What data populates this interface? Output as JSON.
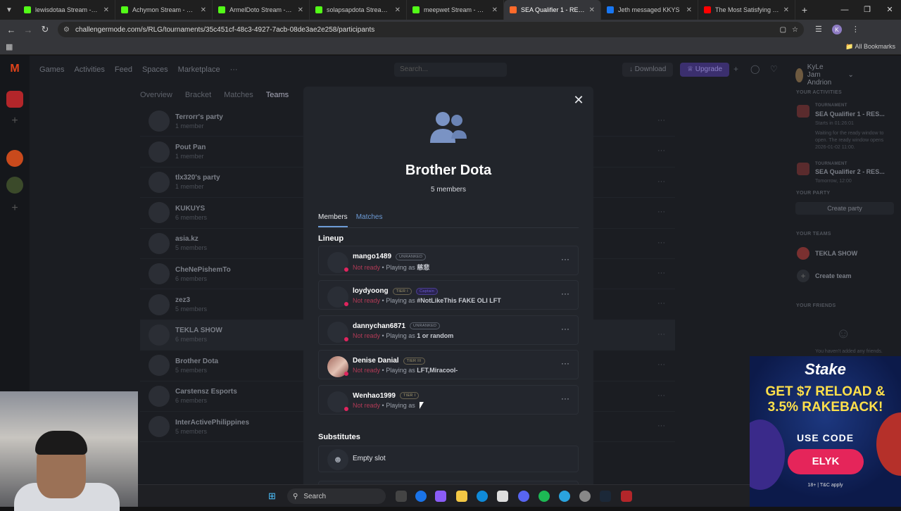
{
  "browser": {
    "tabs": [
      {
        "title": "lewisdotaa Stream - Watc",
        "fav": "#53fc18"
      },
      {
        "title": "Achymon Stream - Watch",
        "fav": "#53fc18"
      },
      {
        "title": "ArmelDoto Stream - Watc",
        "fav": "#53fc18"
      },
      {
        "title": "solapsapdota Stream - W",
        "fav": "#53fc18"
      },
      {
        "title": "meepwet Stream - Watch",
        "fav": "#53fc18"
      },
      {
        "title": "SEA Qualifier 1 - RES Unc",
        "fav": "#ff6a2b"
      },
      {
        "title": "Jeth messaged KKYS",
        "fav": "#1877f2"
      },
      {
        "title": "The Most Satisfying Beat",
        "fav": "#ff0000"
      }
    ],
    "url": "challengermode.com/s/RLG/tournaments/35c451cf-48c3-4927-7acb-08de3ae2e258/participants",
    "all_bookmarks": "All Bookmarks",
    "profile_initial": "K"
  },
  "topnav": {
    "items": [
      "Games",
      "Activities",
      "Feed",
      "Spaces",
      "Marketplace",
      "···"
    ],
    "search_placeholder": "Search...",
    "download": "Download",
    "upgrade": "Upgrade",
    "username": "KyLe Jam Andrion"
  },
  "subnav": {
    "items": [
      "Overview",
      "Bracket",
      "Matches",
      "Teams"
    ]
  },
  "teams": [
    {
      "name": "Terrorr's party",
      "members": "1 member"
    },
    {
      "name": "Pout Pan",
      "members": "1 member"
    },
    {
      "name": "tlx320's party",
      "members": "1 member"
    },
    {
      "name": "KUKUYS",
      "members": "6 members"
    },
    {
      "name": "asia.kz",
      "members": "5 members"
    },
    {
      "name": "CheNePishemTo",
      "members": "6 members"
    },
    {
      "name": "zez3",
      "members": "5 members"
    },
    {
      "name": "TEKLA SHOW",
      "members": "6 members"
    },
    {
      "name": "Brother Dota",
      "members": "5 members"
    },
    {
      "name": "Carstensz Esports",
      "members": "6 members"
    },
    {
      "name": "InterActivePhilippines",
      "members": "5 members"
    }
  ],
  "sidebar": {
    "activities_header": "YOUR ACTIVITIES",
    "a1_kind": "TOURNAMENT",
    "a1_title": "SEA Qualifier 1 - RES...",
    "a1_when": "Starts in 01:26:01",
    "a1_note": "Waiting for the ready window to open. The ready window opens 2026-01-02 11:00.",
    "a2_kind": "TOURNAMENT",
    "a2_title": "SEA Qualifier 2 - RES...",
    "a2_when": "Tomorrow, 12:00",
    "party_header": "YOUR PARTY",
    "create_party": "Create party",
    "teams_header": "YOUR TEAMS",
    "team1": "TEKLA SHOW",
    "create_team": "Create team",
    "friends_header": "YOUR FRIENDS",
    "no_friends": "You haven't added any friends."
  },
  "modal": {
    "title": "Brother Dota",
    "subtitle": "5 members",
    "tab_members": "Members",
    "tab_matches": "Matches",
    "lineup_label": "Lineup",
    "substitutes_label": "Substitutes",
    "empty_slot": "Empty slot",
    "players": [
      {
        "name": "mango1489",
        "badge": "UNRANKED",
        "status": "Not ready",
        "playing": "Playing as",
        "alias": "慈悲",
        "photo": false
      },
      {
        "name": "loydyoong",
        "badge": "TIER I",
        "badge2": "Captain",
        "status": "Not ready",
        "playing": "Playing as",
        "alias": "#NotLikeThis FAKE OLI LFT",
        "photo": false
      },
      {
        "name": "dannychan6871",
        "badge": "UNRANKED",
        "status": "Not ready",
        "playing": "Playing as",
        "alias": "1 or random",
        "photo": false
      },
      {
        "name": "Denise Danial",
        "badge": "TIER III",
        "status": "Not ready",
        "playing": "Playing as",
        "alias": "LFT,Miracool-",
        "photo": true
      },
      {
        "name": "Wenhao1999",
        "badge": "TIER I",
        "status": "Not ready",
        "playing": "Playing as",
        "alias": "",
        "photo": false
      }
    ]
  },
  "ad": {
    "brand": "Stake",
    "headline": "GET $7 RELOAD & 3.5% RAKEBACK!",
    "use_code": "USE CODE",
    "code": "ELYK",
    "terms": "18+ | T&C apply"
  },
  "taskbar": {
    "search": "Search"
  },
  "colors": {
    "accent": "#6d9bd6",
    "not_ready": "#b23a56",
    "upgrade": "#3b2f6e"
  }
}
